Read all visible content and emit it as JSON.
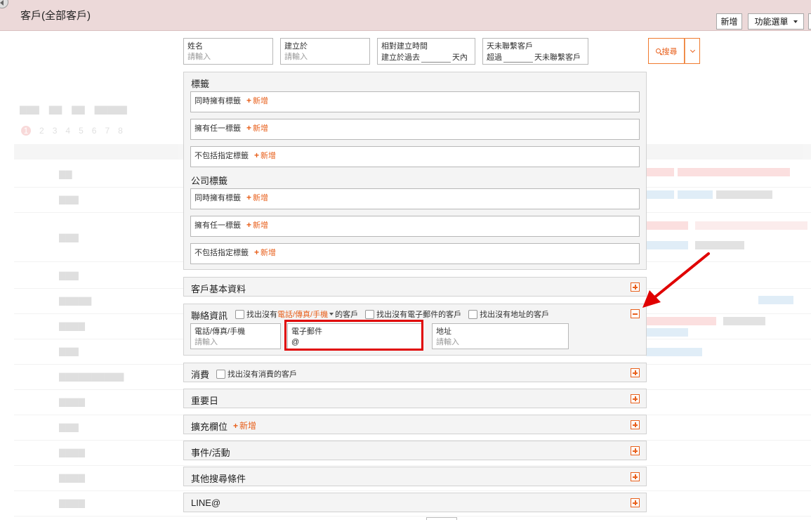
{
  "header": {
    "title": "客戶(全部客戶)",
    "new_button": "新增",
    "menu_button": "功能選單"
  },
  "filters": {
    "name": {
      "label": "姓名",
      "placeholder": "請輸入"
    },
    "created_at": {
      "label": "建立於",
      "placeholder": "請輸入"
    },
    "relative_created": {
      "label": "相對建立時間",
      "prefix": "建立於過去",
      "suffix": "天內"
    },
    "no_contact": {
      "label": "天未聯繫客戶",
      "prefix": "超過",
      "suffix": "天未聯繫客戶"
    }
  },
  "search": {
    "label": "搜尋"
  },
  "tags": {
    "title": "標籤",
    "rows": [
      {
        "label": "同時擁有標籤"
      },
      {
        "label": "擁有任一標籤"
      },
      {
        "label": "不包括指定標籤"
      }
    ],
    "add_label": "新增"
  },
  "company_tags": {
    "title": "公司標籤",
    "rows": [
      {
        "label": "同時擁有標籤"
      },
      {
        "label": "擁有任一標籤"
      },
      {
        "label": "不包括指定標籤"
      }
    ]
  },
  "sections": {
    "basic": "客戶基本資料",
    "contact": {
      "title": "聯絡資訊",
      "opt1_prefix": "找出沒有",
      "opt1_highlight": "電話/傳真/手機",
      "opt1_suffix": "的客戶",
      "opt2": "找出沒有電子郵件的客戶",
      "opt3": "找出沒有地址的客戶",
      "phone": {
        "label": "電話/傳真/手機",
        "placeholder": "請輸入"
      },
      "email": {
        "label": "電子郵件",
        "value": "@"
      },
      "address": {
        "label": "地址",
        "placeholder": "請輸入"
      }
    },
    "spend": {
      "title": "消費",
      "option": "找出沒有消費的客戶"
    },
    "important_date": "重要日",
    "custom_fields": {
      "title": "擴充欄位",
      "add": "新增"
    },
    "events": "事件/活動",
    "other": "其他搜尋條件",
    "line": "LINE@"
  },
  "colors": {
    "accent": "#e8601c",
    "highlight": "#e00000",
    "header_bg": "#ecd9d9"
  }
}
